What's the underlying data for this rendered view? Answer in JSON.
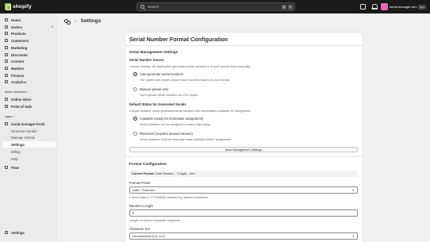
{
  "topbar": {
    "logo_text": "shopify",
    "search_placeholder": "Search",
    "shortcut_key1": "⌘",
    "shortcut_key2": "K",
    "store_name": "serial-manager-dev",
    "dev_badge": "Dev"
  },
  "sidebar": {
    "items": [
      {
        "label": "Home"
      },
      {
        "label": "Orders",
        "count": "3"
      },
      {
        "label": "Products"
      },
      {
        "label": "Customers"
      },
      {
        "label": "Marketing"
      },
      {
        "label": "Discounts"
      },
      {
        "label": "Content"
      },
      {
        "label": "Markets"
      },
      {
        "label": "Finance"
      },
      {
        "label": "Analytics"
      }
    ],
    "sales_channels_label": "Sales channels",
    "channels": [
      {
        "label": "Online Store"
      },
      {
        "label": "Point of Sale"
      }
    ],
    "apps_label": "Apps",
    "app_name": "serial-manager-fresh",
    "app_sub": [
      {
        "label": "Generate Serials"
      },
      {
        "label": "Manage Serials"
      },
      {
        "label": "Settings"
      },
      {
        "label": "Billing"
      },
      {
        "label": "Help"
      }
    ],
    "flow_label": "Flow",
    "settings_label": "Settings"
  },
  "page": {
    "title": "Settings"
  },
  "card": {
    "title": "Serial Number Format Configuration",
    "mgmt_heading": "Serial Management Settings",
    "source_heading": "Serial Number Source",
    "source_help": "Choose whether the application generates serial numbers or if you'll upload them manually",
    "opt_auto_label": "Auto-generate serial numbers",
    "opt_auto_help": "The system will create unique serial numbers based on your format",
    "opt_manual_label": "Manual upload only",
    "opt_manual_help": "You'll upload serial numbers via CSV import",
    "status_heading": "Default Status for Generated Serials",
    "status_help": "Choose whether newly generated serial numbers are immediately available for assignment",
    "opt_avail_label": "Available (ready for immediate assignment)",
    "opt_avail_help": "Serial numbers can be assigned to orders right away",
    "opt_reserved_label": "Reserved (requires manual release)",
    "opt_reserved_help": "Serial numbers must be manually made available before assignment",
    "save_button": "Save Management Settings",
    "format_heading": "Format Configuration",
    "current_format_label": "Current Format:",
    "current_format_value": "Date Random - 3 Digits - Hex",
    "preset_label": "Format Preset",
    "preset_value": "Date + Random",
    "preset_help": "Current date (YYYYMMDD) followed by random characters",
    "random_length_label": "Random Length",
    "random_length_value": "5",
    "random_length_help": "Length of random character segments",
    "charset_label": "Character Set",
    "charset_value": "Hexadecimal (0-9, A-F)"
  },
  "colors": {
    "topbar": "#1a1a1a",
    "sidebar": "#ebebeb",
    "background": "#f1f1f1",
    "logo_green": "#95bf47",
    "avatar": "#e56bb0"
  }
}
